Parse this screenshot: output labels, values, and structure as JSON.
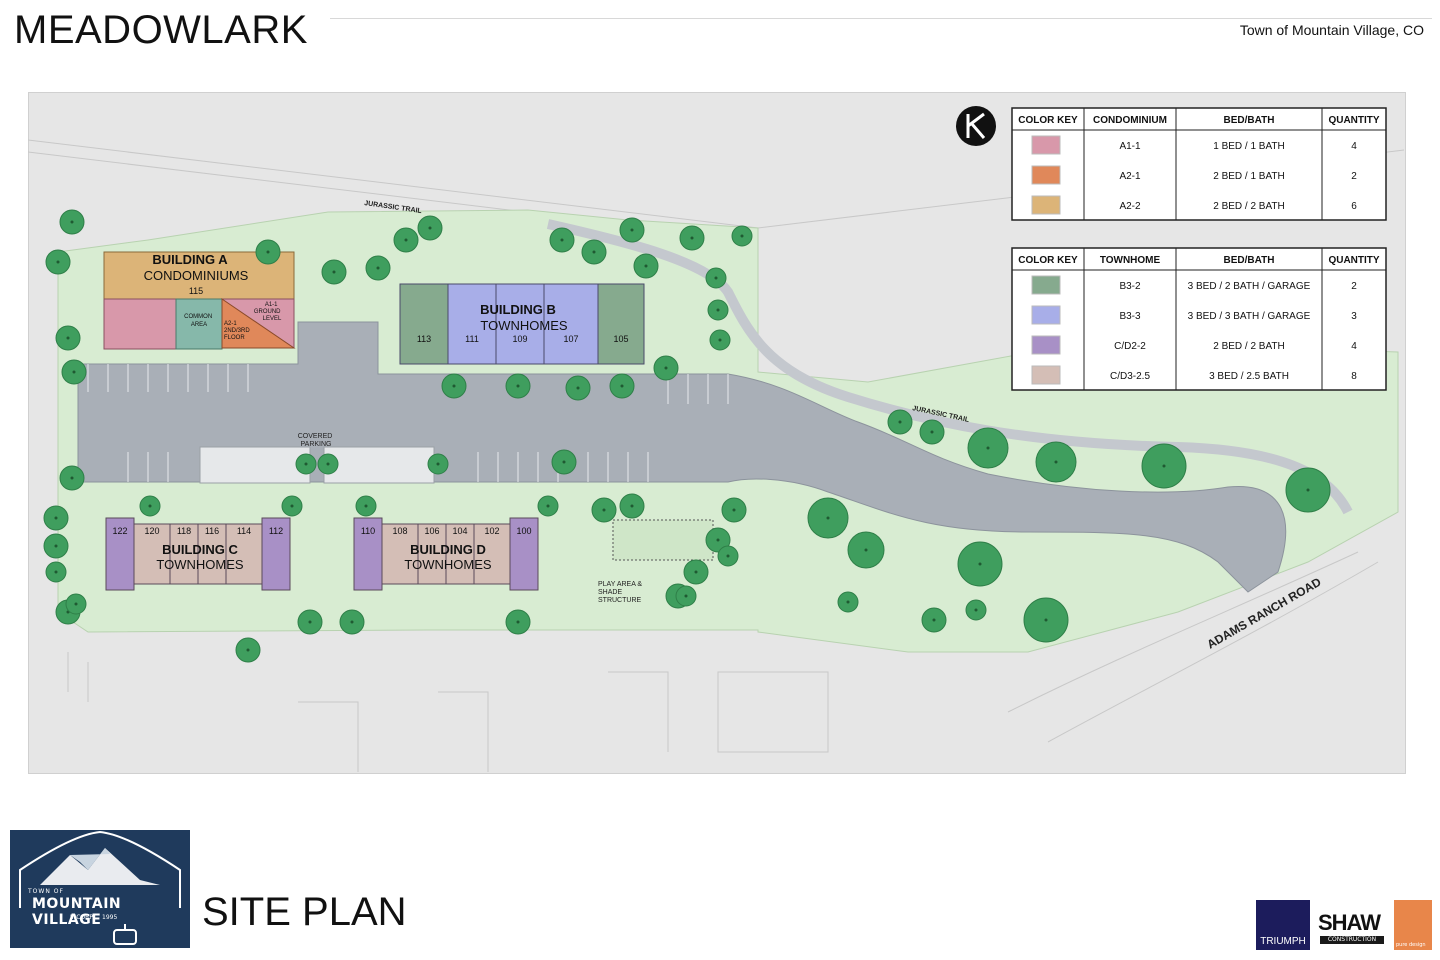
{
  "header": {
    "title": "MEADOWLARK",
    "location": "Town of Mountain Village, CO"
  },
  "sheet_title": "SITE PLAN",
  "legend_condo": {
    "headers": [
      "COLOR KEY",
      "CONDOMINIUM",
      "BED/BATH",
      "QUANTITY"
    ],
    "rows": [
      {
        "color": "#d898aa",
        "type": "A1-1",
        "bedbath": "1 BED / 1 BATH",
        "qty": "4"
      },
      {
        "color": "#e0885a",
        "type": "A2-1",
        "bedbath": "2 BED / 1 BATH",
        "qty": "2"
      },
      {
        "color": "#dcb478",
        "type": "A2-2",
        "bedbath": "2 BED / 2 BATH",
        "qty": "6"
      }
    ]
  },
  "legend_townhome": {
    "headers": [
      "COLOR KEY",
      "TOWNHOME",
      "BED/BATH",
      "QUANTITY"
    ],
    "rows": [
      {
        "color": "#86aa8e",
        "type": "B3-2",
        "bedbath": "3 BED / 2 BATH / GARAGE",
        "qty": "2"
      },
      {
        "color": "#a8aee8",
        "type": "B3-3",
        "bedbath": "3 BED / 3 BATH / GARAGE",
        "qty": "3"
      },
      {
        "color": "#a890c6",
        "type": "C/D2-2",
        "bedbath": "2 BED / 2 BATH",
        "qty": "4"
      },
      {
        "color": "#d4beb6",
        "type": "C/D3-2.5",
        "bedbath": "3 BED / 2.5 BATH",
        "qty": "8"
      }
    ]
  },
  "buildings": {
    "a": {
      "name": "BUILDING A",
      "type": "CONDOMINIUMS",
      "unit": "115",
      "common": [
        "COMMON",
        "AREA"
      ],
      "a21": [
        "A2-1",
        "2ND/3RD",
        "FLOOR"
      ],
      "a11": [
        "A1-1",
        "GROUND",
        "LEVEL"
      ]
    },
    "b": {
      "name": "BUILDING B",
      "type": "TOWNHOMES",
      "units": [
        "113",
        "111",
        "109",
        "107",
        "105"
      ]
    },
    "c": {
      "name": "BUILDING C",
      "type": "TOWNHOMES",
      "units": [
        "122",
        "120",
        "118",
        "116",
        "114",
        "112"
      ]
    },
    "d": {
      "name": "BUILDING D",
      "type": "TOWNHOMES",
      "units": [
        "110",
        "108",
        "106",
        "104",
        "102",
        "100"
      ]
    }
  },
  "labels": {
    "covered_parking": [
      "COVERED",
      "PARKING"
    ],
    "play_area": [
      "PLAY AREA &",
      "SHADE",
      "STRUCTURE"
    ],
    "jurassic_trail": "JURASSIC TRAIL",
    "adams_ranch_road": "ADAMS RANCH ROAD"
  },
  "logos": {
    "mv_small": "TOWN OF",
    "mv_main": "MOUNTAIN VILLAGE",
    "mv_inc": "INCORP.",
    "mv_year": "1995",
    "triumph": "TRIUMPH",
    "shaw": "SHAW",
    "shaw_sub": "CONSTRUCTION",
    "pd": "pure design"
  },
  "colors": {
    "grass": "#d8ecd2",
    "pavement": "#a9afb7",
    "tree": "#3f9e5e",
    "tree_dark": "#2f7f48"
  }
}
